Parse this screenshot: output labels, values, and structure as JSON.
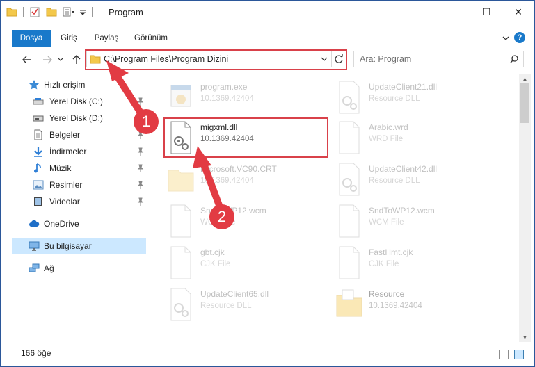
{
  "window": {
    "title": "Program",
    "controls": {
      "minimize": "—",
      "maximize": "☐",
      "close": "✕"
    }
  },
  "ribbon": {
    "tabs": [
      {
        "label": "Dosya",
        "active": true
      },
      {
        "label": "Giriş"
      },
      {
        "label": "Paylaş"
      },
      {
        "label": "Görünüm"
      }
    ],
    "help_glyph": "?"
  },
  "address": {
    "path": "C:\\Program Files\\Program Dizini",
    "search_placeholder": "Ara: Program"
  },
  "sidebar": {
    "quick_access": "Hızlı erişim",
    "items": [
      {
        "label": "Yerel Disk (C:)",
        "icon": "drive-icon",
        "pinned": true
      },
      {
        "label": "Yerel Disk (D:)",
        "icon": "drive-icon",
        "pinned": false
      },
      {
        "label": "Belgeler",
        "icon": "documents-icon",
        "pinned": true
      },
      {
        "label": "İndirmeler",
        "icon": "downloads-icon",
        "pinned": true
      },
      {
        "label": "Müzik",
        "icon": "music-icon",
        "pinned": true
      },
      {
        "label": "Resimler",
        "icon": "pictures-icon",
        "pinned": true
      },
      {
        "label": "Videolar",
        "icon": "videos-icon",
        "pinned": true
      }
    ],
    "onedrive": "OneDrive",
    "this_pc": "Bu bilgisayar",
    "network": "Ağ"
  },
  "files": [
    {
      "name": "program.exe",
      "sub": "10.1369.42404",
      "icon": "exe-icon",
      "highlight": false
    },
    {
      "name": "UpdateClient21.dll",
      "sub": "Resource DLL",
      "icon": "dll-icon",
      "highlight": false
    },
    {
      "name": "migxml.dll",
      "sub": "10.1369.42404",
      "icon": "dll-icon",
      "highlight": true
    },
    {
      "name": "Arabic.wrd",
      "sub": "WRD File",
      "icon": "file-icon",
      "highlight": false
    },
    {
      "name": "Microsoft.VC90.CRT",
      "sub": "10.1369.42404",
      "icon": "folder-icon",
      "highlight": false
    },
    {
      "name": "UpdateClient42.dll",
      "sub": "Resource DLL",
      "icon": "dll-icon",
      "highlight": false
    },
    {
      "name": "SndToWP12.wcm",
      "sub": "WCM File",
      "icon": "file-icon",
      "highlight": false
    },
    {
      "name": "SndToWP12.wcm",
      "sub": "WCM File",
      "icon": "file-icon",
      "highlight": false
    },
    {
      "name": "gbt.cjk",
      "sub": "CJK File",
      "icon": "file-icon",
      "highlight": false
    },
    {
      "name": "FastHmt.cjk",
      "sub": "CJK File",
      "icon": "file-icon",
      "highlight": false
    },
    {
      "name": "UpdateClient65.dll",
      "sub": "Resource DLL",
      "icon": "dll-icon",
      "highlight": false
    },
    {
      "name": "Resource",
      "sub": "10.1369.42404",
      "icon": "folder-icon",
      "highlight": false
    }
  ],
  "status": {
    "count": "166 öğe"
  },
  "annotations": {
    "step1": "1",
    "step2": "2"
  },
  "colors": {
    "accent": "#1979ca",
    "selection": "#cce8ff",
    "annotation": "#d9414a"
  }
}
